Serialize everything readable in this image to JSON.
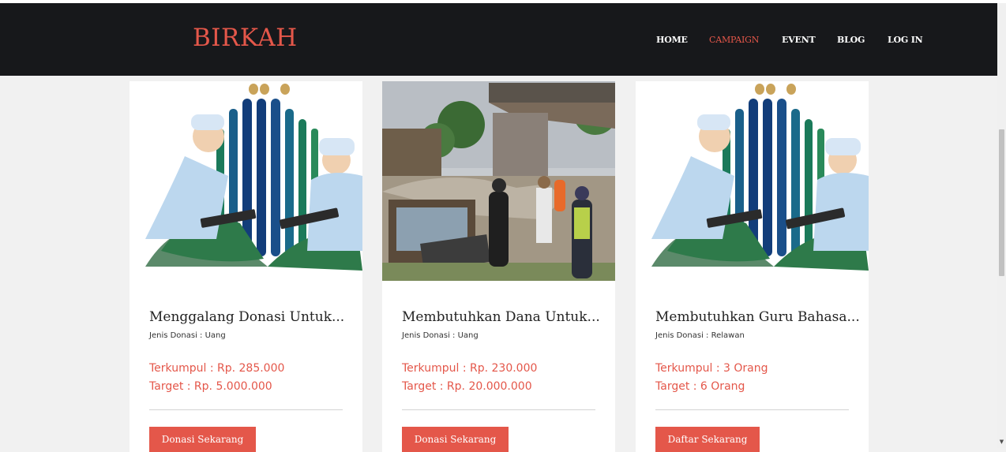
{
  "header": {
    "brand": "BIRKAH",
    "nav": [
      {
        "label": "HOME",
        "active": false
      },
      {
        "label": "CAMPAIGN",
        "active": true
      },
      {
        "label": "EVENT",
        "active": false
      },
      {
        "label": "BLOG",
        "active": false
      },
      {
        "label": "LOG IN",
        "active": false
      }
    ]
  },
  "colors": {
    "accent": "#e4574a",
    "navbar": "#17181b",
    "page_bg": "#f1f1f1"
  },
  "campaigns": [
    {
      "image": "illustration-two-men-reading",
      "title": "Menggalang Donasi Untuk...",
      "type": "Jenis Donasi : Uang",
      "collected": "Terkumpul : Rp. 285.000",
      "target": "Target : Rp. 5.000.000",
      "button": "Donasi Sekarang"
    },
    {
      "image": "photo-disaster-site",
      "title": "Membutuhkan Dana Untuk...",
      "type": "Jenis Donasi : Uang",
      "collected": "Terkumpul : Rp. 230.000",
      "target": "Target : Rp. 20.000.000",
      "button": "Donasi Sekarang"
    },
    {
      "image": "illustration-two-men-reading",
      "title": "Membutuhkan Guru Bahasa...",
      "type": "Jenis Donasi : Relawan",
      "collected": "Terkumpul : 3 Orang",
      "target": "Target : 6 Orang",
      "button": "Daftar Sekarang"
    }
  ]
}
